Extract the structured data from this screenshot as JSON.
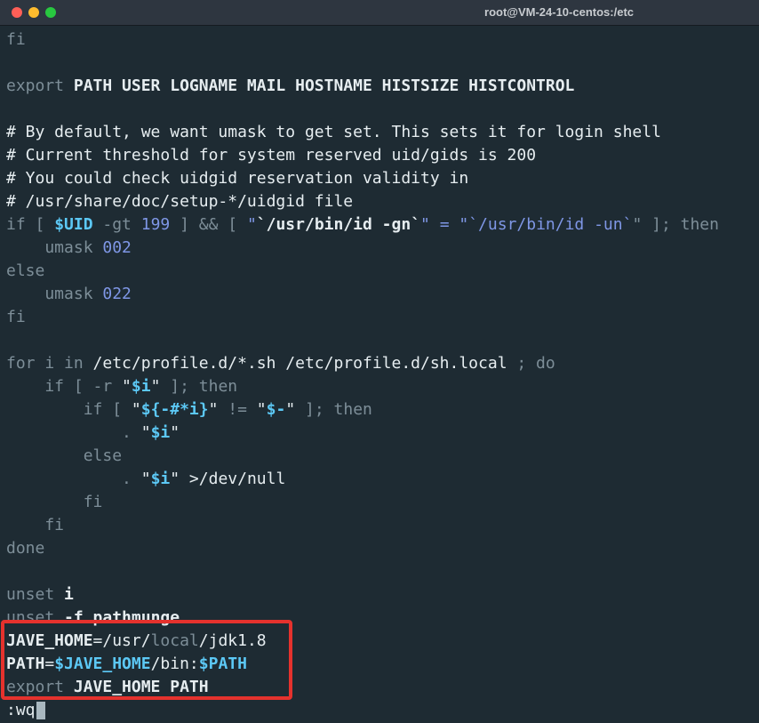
{
  "window": {
    "title": "root@VM-24-10-centos:/etc"
  },
  "colors": {
    "background": "#1e2b33",
    "highlight_box": "#e5322d",
    "variable": "#5cc8f5",
    "number": "#7f97e6"
  },
  "lines": [
    {
      "segs": [
        {
          "t": "fi",
          "c": "keyword"
        }
      ]
    },
    {
      "segs": [
        {
          "t": "",
          "c": "normal"
        }
      ]
    },
    {
      "segs": [
        {
          "t": "export ",
          "c": "keyword"
        },
        {
          "t": "PATH USER LOGNAME MAIL HOSTNAME HISTSIZE HISTCONTROL",
          "c": "white"
        }
      ]
    },
    {
      "segs": [
        {
          "t": "",
          "c": "normal"
        }
      ]
    },
    {
      "segs": [
        {
          "t": "# By default, we want umask to get set. This sets it for login shell",
          "c": "comment"
        }
      ]
    },
    {
      "segs": [
        {
          "t": "# Current threshold for system reserved uid/gids is 200",
          "c": "comment"
        }
      ]
    },
    {
      "segs": [
        {
          "t": "# You could check uidgid reservation validity in",
          "c": "comment"
        }
      ]
    },
    {
      "segs": [
        {
          "t": "# /usr/share/doc/setup-*/uidgid file",
          "c": "comment"
        }
      ]
    },
    {
      "segs": [
        {
          "t": "if [ ",
          "c": "keyword"
        },
        {
          "t": "$UID",
          "c": "var"
        },
        {
          "t": " -gt ",
          "c": "op"
        },
        {
          "t": "199",
          "c": "num"
        },
        {
          "t": " ] && [ ",
          "c": "keyword"
        },
        {
          "t": "\"",
          "c": "str"
        },
        {
          "t": "`/usr/bin/id -gn`",
          "c": "bold"
        },
        {
          "t": "\" = \"",
          "c": "str"
        },
        {
          "t": "`/usr/bin/id -un`",
          "c": "num"
        },
        {
          "t": "\" ]; then",
          "c": "keyword"
        }
      ]
    },
    {
      "segs": [
        {
          "t": "    umask ",
          "c": "keyword"
        },
        {
          "t": "002",
          "c": "num"
        }
      ]
    },
    {
      "segs": [
        {
          "t": "else",
          "c": "keyword"
        }
      ]
    },
    {
      "segs": [
        {
          "t": "    umask ",
          "c": "keyword"
        },
        {
          "t": "022",
          "c": "num"
        }
      ]
    },
    {
      "segs": [
        {
          "t": "fi",
          "c": "keyword"
        }
      ]
    },
    {
      "segs": [
        {
          "t": "",
          "c": "normal"
        }
      ]
    },
    {
      "segs": [
        {
          "t": "for i in ",
          "c": "keyword"
        },
        {
          "t": "/etc/profile.d/*.sh /etc/profile.d/sh.local",
          "c": "comment"
        },
        {
          "t": " ; do",
          "c": "keyword"
        }
      ]
    },
    {
      "segs": [
        {
          "t": "    if [ -r ",
          "c": "keyword"
        },
        {
          "t": "\"",
          "c": "comment"
        },
        {
          "t": "$i",
          "c": "var"
        },
        {
          "t": "\"",
          "c": "comment"
        },
        {
          "t": " ]; then",
          "c": "keyword"
        }
      ]
    },
    {
      "segs": [
        {
          "t": "        if [ ",
          "c": "keyword"
        },
        {
          "t": "\"",
          "c": "comment"
        },
        {
          "t": "${-#*i}",
          "c": "var"
        },
        {
          "t": "\"",
          "c": "comment"
        },
        {
          "t": " != ",
          "c": "keyword"
        },
        {
          "t": "\"",
          "c": "comment"
        },
        {
          "t": "$-",
          "c": "var"
        },
        {
          "t": "\"",
          "c": "comment"
        },
        {
          "t": " ]; then",
          "c": "keyword"
        }
      ]
    },
    {
      "segs": [
        {
          "t": "            . ",
          "c": "keyword"
        },
        {
          "t": "\"",
          "c": "comment"
        },
        {
          "t": "$i",
          "c": "var"
        },
        {
          "t": "\"",
          "c": "comment"
        }
      ]
    },
    {
      "segs": [
        {
          "t": "        else",
          "c": "keyword"
        }
      ]
    },
    {
      "segs": [
        {
          "t": "            . ",
          "c": "keyword"
        },
        {
          "t": "\"",
          "c": "comment"
        },
        {
          "t": "$i",
          "c": "var"
        },
        {
          "t": "\"",
          "c": "comment"
        },
        {
          "t": " >/dev/null",
          "c": "comment"
        }
      ]
    },
    {
      "segs": [
        {
          "t": "        fi",
          "c": "keyword"
        }
      ]
    },
    {
      "segs": [
        {
          "t": "    fi",
          "c": "keyword"
        }
      ]
    },
    {
      "segs": [
        {
          "t": "done",
          "c": "keyword"
        }
      ]
    },
    {
      "segs": [
        {
          "t": "",
          "c": "normal"
        }
      ]
    },
    {
      "segs": [
        {
          "t": "unset ",
          "c": "keyword"
        },
        {
          "t": "i",
          "c": "white"
        }
      ]
    },
    {
      "segs": [
        {
          "t": "unset ",
          "c": "keyword"
        },
        {
          "t": "-f pathmunge",
          "c": "white"
        }
      ]
    },
    {
      "segs": [
        {
          "t": "JAVE_HOME",
          "c": "white"
        },
        {
          "t": "=/usr/",
          "c": "comment"
        },
        {
          "t": "local",
          "c": "keyword"
        },
        {
          "t": "/jdk1.8",
          "c": "comment"
        }
      ]
    },
    {
      "segs": [
        {
          "t": "PATH",
          "c": "white"
        },
        {
          "t": "=",
          "c": "comment"
        },
        {
          "t": "$JAVE_HOME",
          "c": "var"
        },
        {
          "t": "/bin:",
          "c": "comment"
        },
        {
          "t": "$PATH",
          "c": "var"
        }
      ]
    },
    {
      "segs": [
        {
          "t": "export ",
          "c": "keyword"
        },
        {
          "t": "JAVE_HOME PATH",
          "c": "white"
        }
      ]
    },
    {
      "segs": [
        {
          "t": ":wq",
          "c": "comment"
        }
      ],
      "cursor": true
    }
  ]
}
